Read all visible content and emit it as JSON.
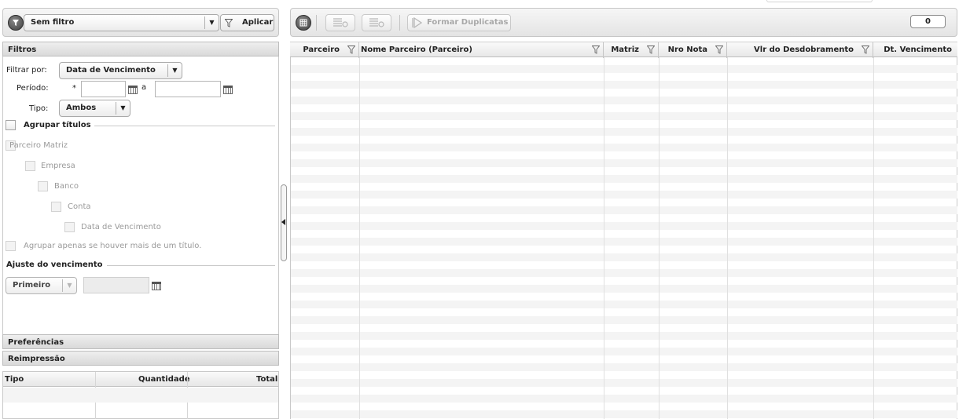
{
  "left_toolbar": {
    "filter_value": "Sem filtro",
    "apply_label": "Aplicar"
  },
  "right_toolbar": {
    "form_duplicatas_label": "Formar Duplicatas",
    "count": "0"
  },
  "filtros": {
    "header": "Filtros",
    "filtrar_por_label": "Filtrar por:",
    "filtrar_por_value": "Data de Vencimento",
    "periodo_label": "Período:",
    "periodo_required": "*",
    "periodo_sep": "a",
    "tipo_label": "Tipo:",
    "tipo_value": "Ambos",
    "agrupar_titulos": "Agrupar títulos",
    "parceiro_matriz": "Parceiro Matriz",
    "empresa": "Empresa",
    "banco": "Banco",
    "conta": "Conta",
    "data_vencimento": "Data de Vencimento",
    "agrupar_apenas": "Agrupar apenas se houver mais de um título.",
    "ajuste_header": "Ajuste do vencimento",
    "ajuste_value": "Primeiro"
  },
  "preferencias": "Preferências",
  "reimpressao": "Reimpressão",
  "summary_table": {
    "headers": [
      "Tipo",
      "Quantidade",
      "Total"
    ]
  },
  "main_grid": {
    "headers": [
      "Parceiro",
      "Nome Parceiro (Parceiro)",
      "Matriz",
      "Nro Nota",
      "Vlr do Desdobramento",
      "Dt. Vencimento"
    ]
  }
}
